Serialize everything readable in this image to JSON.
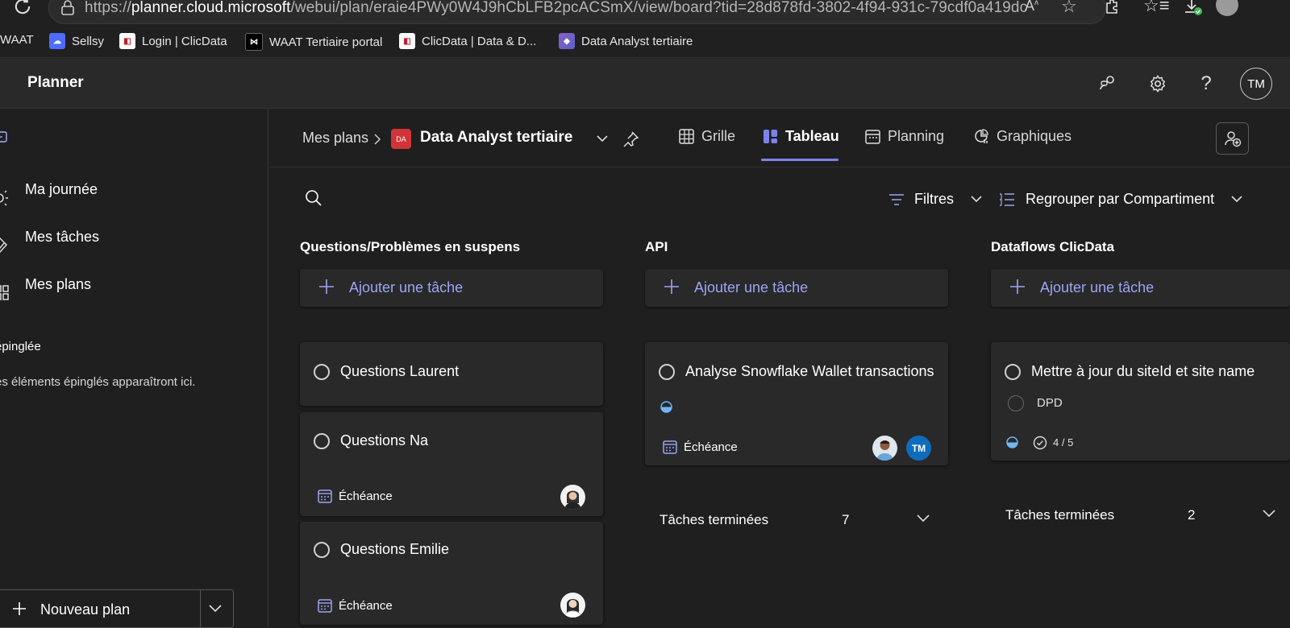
{
  "browser": {
    "url_prefix": "https://",
    "url_host": "planner.cloud.microsoft",
    "url_path": "/webui/plan/eraie4PWy0W4J9hCbLFB2pcACSmX/view/board?tid=28d878fd-3802-4f94-931c-79cdf0a419dc",
    "bookmarks": [
      {
        "label": "WAAT"
      },
      {
        "label": "Sellsy"
      },
      {
        "label": "Login | ClicData"
      },
      {
        "label": "WAAT Tertiaire portal"
      },
      {
        "label": "ClicData | Data & D..."
      },
      {
        "label": "Data Analyst tertiaire"
      }
    ]
  },
  "app": {
    "title": "Planner",
    "user_initials": "TM"
  },
  "sidebar": {
    "items": [
      {
        "label": "Ma journée",
        "icon": "sun-icon"
      },
      {
        "label": "Mes tâches",
        "icon": "task-icon"
      },
      {
        "label": "Mes plans",
        "icon": "plans-grid-icon"
      }
    ],
    "pinned_title": "épinglée",
    "pinned_empty": "es éléments épinglés apparaîtront ici.",
    "new_plan_label": "Nouveau plan"
  },
  "plan": {
    "breadcrumb_root": "Mes plans",
    "badge": "DA",
    "name": "Data Analyst tertiaire",
    "tabs": [
      {
        "label": "Grille",
        "active": false
      },
      {
        "label": "Tableau",
        "active": true
      },
      {
        "label": "Planning",
        "active": false
      },
      {
        "label": "Graphiques",
        "active": false
      }
    ]
  },
  "toolbar": {
    "filters_label": "Filtres",
    "group_label": "Regrouper par Compartiment"
  },
  "board": {
    "add_task_label": "Ajouter une tâche",
    "due_label": "Échéance",
    "done_label": "Tâches terminées",
    "columns": [
      {
        "title": "Questions/Problèmes en suspens",
        "cards": [
          {
            "title": "Questions Laurent"
          },
          {
            "title": "Questions Na",
            "due": "Échéance"
          },
          {
            "title": "Questions Emilie",
            "due": "Échéance"
          }
        ]
      },
      {
        "title": "API",
        "cards": [
          {
            "title": "Analyse Snowflake Wallet transactions",
            "due": "Échéance",
            "assignee_initials": "TM",
            "progress": "in progress"
          }
        ],
        "done_count": "7"
      },
      {
        "title": "Dataflows ClicData",
        "cards": [
          {
            "title": "Mettre à jour du siteId et site name",
            "subtask": "DPD",
            "checklist": "4 / 5",
            "progress": "in progress"
          }
        ],
        "done_count": "2"
      }
    ]
  },
  "colors": {
    "accent": "#7b83eb",
    "background": "#1f1f1f",
    "card": "#292929",
    "badge_red": "#d13438",
    "avatar_blue": "#0f6cbd"
  }
}
